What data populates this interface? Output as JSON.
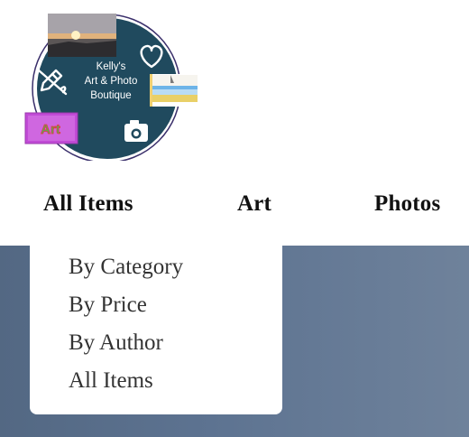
{
  "logo": {
    "line1": "Kelly's",
    "line2": "Art & Photo",
    "line3": "Boutique",
    "badge_text": "Art",
    "badge_color": "#c14bd6",
    "circle_color": "#204a5e",
    "ring_color": "#3a2f6b"
  },
  "nav": {
    "items": [
      {
        "label": "All Items"
      },
      {
        "label": "Art"
      },
      {
        "label": "Photos"
      }
    ]
  },
  "dropdown": {
    "items": [
      {
        "label": "By Category"
      },
      {
        "label": "By Price"
      },
      {
        "label": "By Author"
      },
      {
        "label": "All Items"
      }
    ]
  },
  "colors": {
    "hero_start": "#536883",
    "hero_end": "#6f829b",
    "nav_text": "#111111",
    "dropdown_text": "#333333"
  }
}
